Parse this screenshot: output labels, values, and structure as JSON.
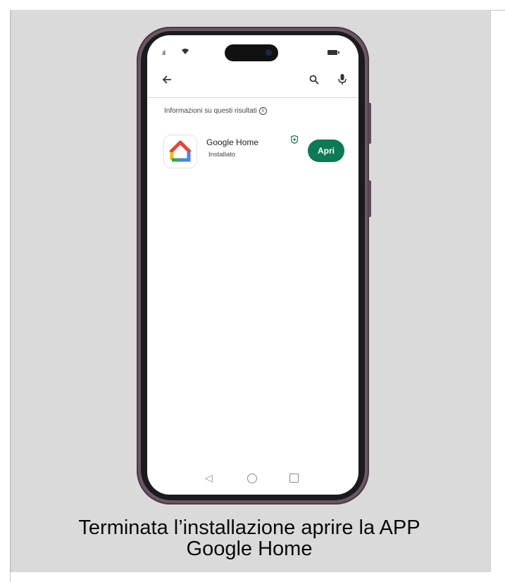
{
  "status_bar": {
    "signal": ".ıll"
  },
  "search_bar": {
    "back_icon": "arrow-left-icon",
    "search_icon": "search-icon",
    "mic_icon": "mic-icon"
  },
  "results_info": {
    "text": "Informazioni su questi risultati",
    "icon": "info-icon"
  },
  "app_result": {
    "name": "Google Home",
    "status": "Installato",
    "action_label": "Apri",
    "badge_icon": "shield-icon",
    "colors": {
      "button": "#0b7a55",
      "home_red": "#ea4335",
      "home_yellow": "#fbbc04",
      "home_green": "#34a853",
      "home_blue": "#4285f4"
    }
  },
  "nav_bar": {
    "back": "◁",
    "home_icon": "circle-home-icon",
    "recents_icon": "square-recents-icon"
  },
  "caption": {
    "line1": "Terminata l’installazione aprire la APP",
    "line2": "Google Home"
  }
}
